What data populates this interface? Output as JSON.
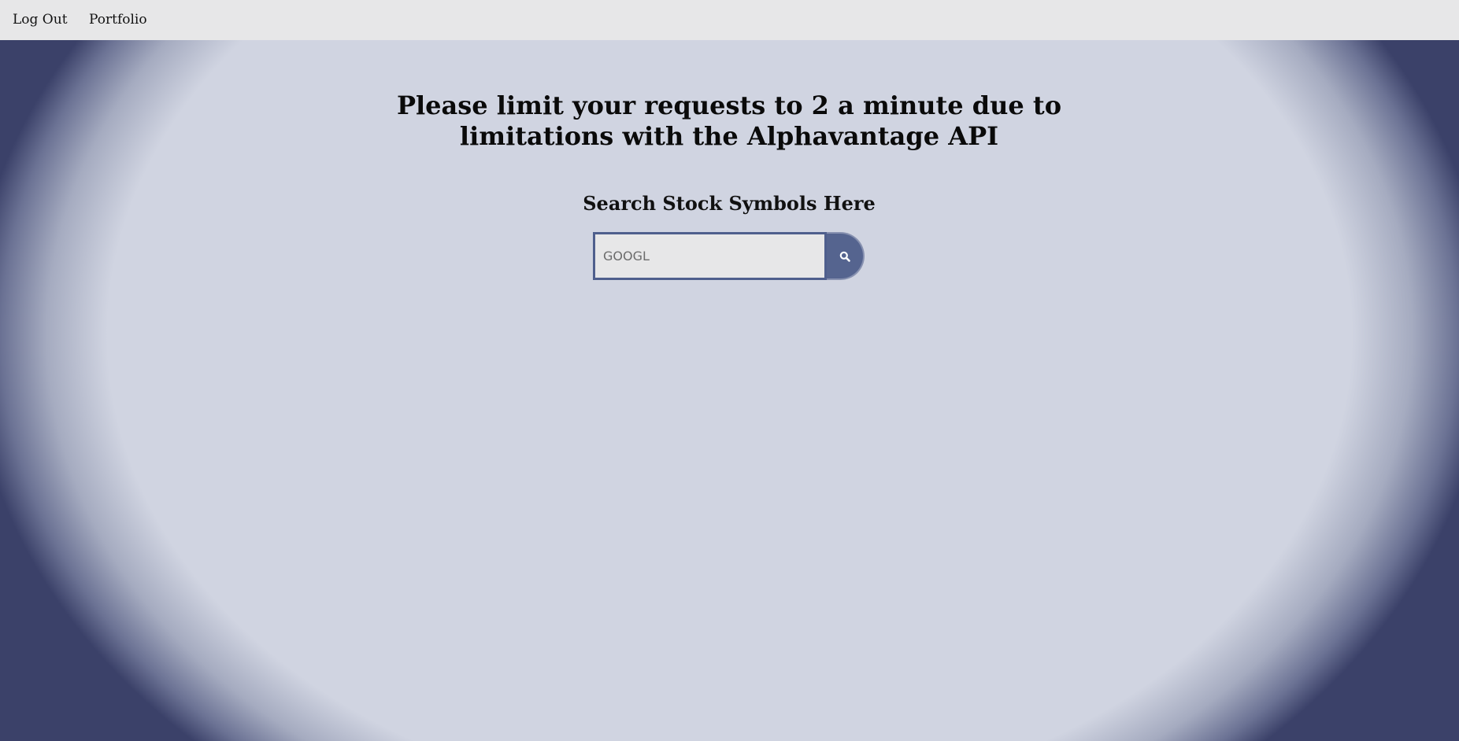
{
  "nav": {
    "logout_label": "Log Out",
    "portfolio_label": "Portfolio"
  },
  "main": {
    "warning": "Please limit your requests to 2 a minute due to limitations with the Alphavantage API",
    "search_heading": "Search Stock Symbols Here"
  },
  "search": {
    "placeholder": "GOOGL",
    "value": "",
    "button_icon": "search-icon"
  },
  "colors": {
    "navbar_bg": "#e7e7e8",
    "page_bg": "#d0d4e1",
    "vignette_edge": "#3b4169",
    "accent": "#55648f"
  }
}
